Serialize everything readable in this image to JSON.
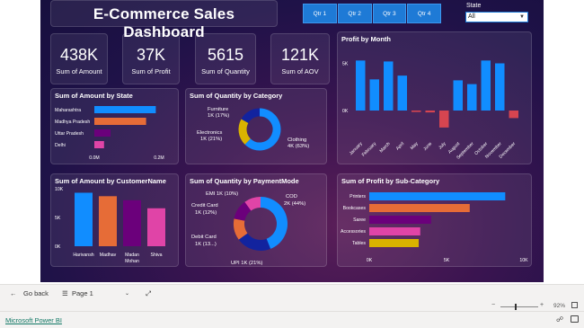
{
  "dashboard": {
    "title": "E-Commerce Sales Dashboard"
  },
  "quarters": [
    "Qtr 1",
    "Qtr 2",
    "Qtr 3",
    "Qtr 4"
  ],
  "state_filter": {
    "label": "State",
    "value": "All"
  },
  "kpis": [
    {
      "value": "438K",
      "label": "Sum of Amount"
    },
    {
      "value": "37K",
      "label": "Sum of Profit"
    },
    {
      "value": "5615",
      "label": "Sum of Quantity"
    },
    {
      "value": "121K",
      "label": "Sum of AOV"
    }
  ],
  "panels": {
    "amount_by_state": "Sum of Amount by State",
    "quantity_by_category": "Sum of Quantity by Category",
    "profit_by_month": "Profit by Month",
    "amount_by_customer": "Sum of Amount by CustomerName",
    "quantity_by_payment": "Sum of Quantity by PaymentMode",
    "profit_by_subcategory": "Sum of Profit by Sub-Category"
  },
  "colors": {
    "blue": "#118dff",
    "orange": "#e66c37",
    "purple": "#6b007b",
    "pink": "#e044a7",
    "navy": "#12239e",
    "yellow": "#d9b300",
    "red": "#d64550"
  },
  "chart_data": [
    {
      "type": "bar",
      "orientation": "horizontal",
      "title": "Sum of Amount by State",
      "categories": [
        "Maharashtra",
        "Madhya Pradesh",
        "Uttar Pradesh",
        "Delhi"
      ],
      "values": [
        0.19,
        0.16,
        0.05,
        0.03
      ],
      "xticks": [
        "0.0M",
        "0.2M"
      ],
      "xlim": [
        0,
        0.2
      ]
    },
    {
      "type": "pie",
      "donut": true,
      "title": "Sum of Quantity by Category",
      "labels": [
        "Clothing",
        "Electronics",
        "Furniture"
      ],
      "values": [
        63,
        21,
        17
      ],
      "label_text": [
        "Clothing\n4K (63%)",
        "Electronics\n1K (21%)",
        "Furniture\n1K (17%)"
      ]
    },
    {
      "type": "bar",
      "title": "Profit by Month",
      "categories": [
        "January",
        "February",
        "March",
        "April",
        "May",
        "June",
        "July",
        "August",
        "September",
        "October",
        "November",
        "December"
      ],
      "values": [
        5300,
        3300,
        5200,
        3700,
        -150,
        -200,
        -1800,
        3200,
        2800,
        5300,
        5000,
        -800
      ],
      "yticks": [
        "5K",
        "0K"
      ],
      "ylim": [
        -2000,
        6000
      ]
    },
    {
      "type": "bar",
      "title": "Sum of Amount by CustomerName",
      "categories": [
        "Harivansh",
        "Madhav",
        "Madan Mohan",
        "Shiva"
      ],
      "values": [
        9300,
        8700,
        8000,
        6600
      ],
      "yticks": [
        "10K",
        "5K",
        "0K"
      ],
      "ylim": [
        0,
        10000
      ]
    },
    {
      "type": "pie",
      "donut": true,
      "title": "Sum of Quantity by PaymentMode",
      "labels": [
        "COD",
        "UPI",
        "Debit Card",
        "Credit Card",
        "EMI"
      ],
      "values": [
        44,
        21,
        13,
        12,
        10
      ],
      "label_text": [
        "COD\n2K (44%)",
        "UPI 1K (21%)",
        "Debit Card\n1K (13...)",
        "Credit Card\n1K (12%)",
        "EMI 1K (10%)"
      ]
    },
    {
      "type": "bar",
      "orientation": "horizontal",
      "title": "Sum of Profit by Sub-Category",
      "categories": [
        "Printers",
        "Bookcases",
        "Saree",
        "Accessories",
        "Tables"
      ],
      "values": [
        8800,
        6500,
        4000,
        3300,
        3200
      ],
      "xticks": [
        "0K",
        "5K",
        "10K"
      ],
      "xlim": [
        0,
        10000
      ]
    }
  ],
  "page_nav": {
    "back": "Go back",
    "page": "Page 1"
  },
  "zoom": {
    "level": "92%"
  },
  "footer": {
    "link": "Microsoft Power BI"
  }
}
